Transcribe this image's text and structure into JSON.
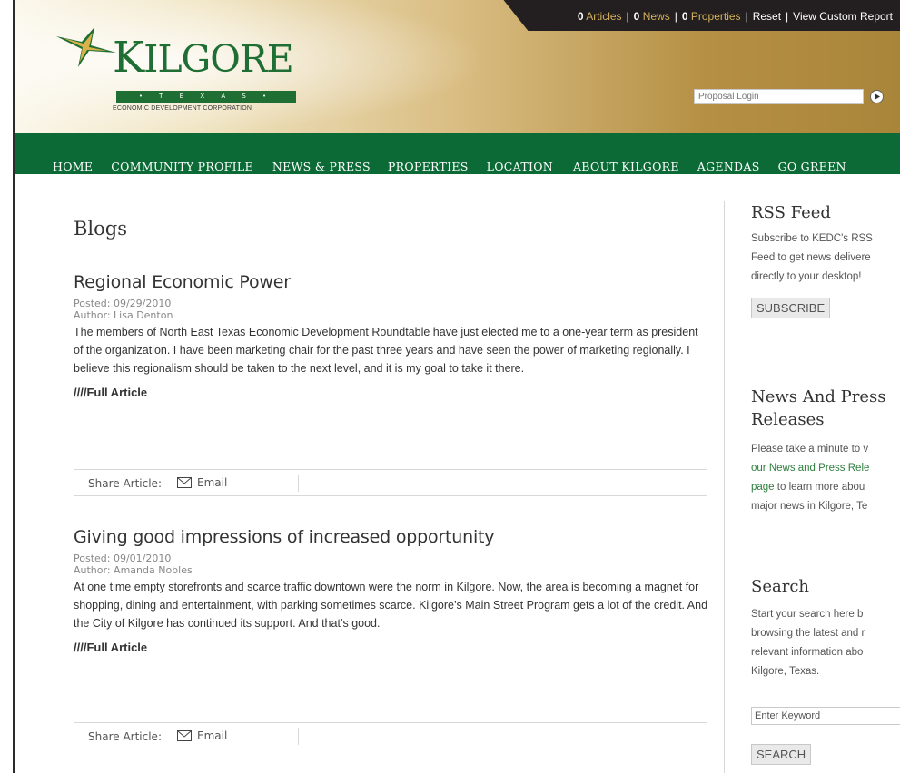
{
  "header": {
    "topbar": {
      "articles_count": "0",
      "articles_label": "Articles",
      "news_count": "0",
      "news_label": "News",
      "properties_count": "0",
      "properties_label": "Properties",
      "reset": "Reset",
      "view_report": "View Custom Report"
    },
    "logo": {
      "name_first": "K",
      "name_rest": "ILGORE",
      "state": "• T E X A S •",
      "tagline": "ECONOMIC DEVELOPMENT CORPORATION"
    },
    "login_placeholder": "Proposal Login"
  },
  "nav": {
    "items": [
      "HOME",
      "COMMUNITY PROFILE",
      "NEWS & PRESS",
      "PROPERTIES",
      "LOCATION",
      "ABOUT KILGORE",
      "AGENDAS",
      "GO GREEN"
    ]
  },
  "main": {
    "title": "Blogs",
    "posts": [
      {
        "title": "Regional Economic Power",
        "posted": "Posted: 09/29/2010",
        "author": "Author: Lisa Denton",
        "body": "The members of North East Texas Economic Development Roundtable have just elected me to a one-year term as president of the organization. I have been marketing chair for the past three years and have seen the power of marketing regionally. I believe this regionalism should be taken to the next level, and it is my goal to take it there.",
        "link": "////Full Article",
        "share_label": "Share Article:",
        "email_label": "Email"
      },
      {
        "title": "Giving good impressions of increased opportunity",
        "posted": "Posted: 09/01/2010",
        "author": "Author: Amanda Nobles",
        "body": "At one time empty storefronts and scarce traffic downtown were the norm in Kilgore. Now, the area is becoming a magnet for shopping, dining and entertainment, with parking sometimes scarce. Kilgore’s Main Street Program gets a lot of the credit. And the City of Kilgore has continued its support.  And that’s good.",
        "link": "////Full Article",
        "share_label": "Share Article:",
        "email_label": "Email"
      }
    ]
  },
  "sidebar": {
    "rss": {
      "title": "RSS Feed",
      "line1": "Subscribe to KEDC's RSS",
      "line2": "Feed to get news delivere",
      "line3": "directly to your desktop!",
      "button": "SUBSCRIBE"
    },
    "news": {
      "title_line1": "News And Press",
      "title_line2": "Releases",
      "line1": "Please take a minute to v",
      "line2_link": "our News and Press Rele",
      "line3_link": "page",
      "line3_rest": " to learn more abou",
      "line4": "major news in Kilgore, Te"
    },
    "search": {
      "title": "Search",
      "line1": "Start your search here b",
      "line2": "browsing the latest and r",
      "line3": "relevant information abo",
      "line4": "Kilgore, Texas.",
      "placeholder": "Enter Keyword",
      "button": "SEARCH"
    }
  },
  "colors": {
    "brand_green": "#0b6a35",
    "logo_green": "#1f6e34",
    "topbar_gold": "#d6b35a",
    "topbar_bg": "#231f20"
  }
}
